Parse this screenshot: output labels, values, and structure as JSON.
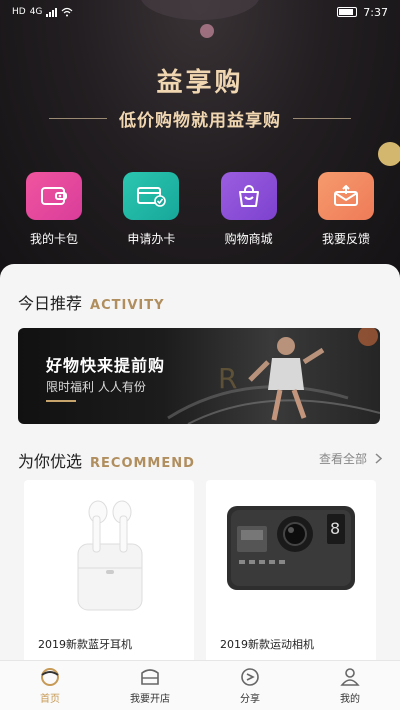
{
  "status_bar": {
    "network": "HD",
    "signal": "4G",
    "time": "7:37"
  },
  "header": {
    "title": "益享购",
    "slogan": "低价购物就用益享购"
  },
  "quick_actions": [
    {
      "label": "我的卡包",
      "icon": "wallet-icon",
      "color": "#e8449e"
    },
    {
      "label": "申请办卡",
      "icon": "card-check-icon",
      "color": "#1fb7a5"
    },
    {
      "label": "购物商城",
      "icon": "shopping-bag-icon",
      "color": "#8d4fd8"
    },
    {
      "label": "我要反馈",
      "icon": "envelope-icon",
      "color": "#f28a62"
    }
  ],
  "today": {
    "title": "今日推荐",
    "subtitle": "ACTIVITY",
    "banner": {
      "title": "好物快来提前购",
      "subtitle": "限时福利 人人有份"
    }
  },
  "recommend": {
    "title": "为你优选",
    "subtitle": "RECOMMEND",
    "view_all": "查看全部",
    "products": [
      {
        "name": "2019新款蓝牙耳机",
        "image": "earbuds-image"
      },
      {
        "name": "2019新款运动相机",
        "image": "action-camera-image"
      }
    ]
  },
  "tabbar": {
    "items": [
      {
        "label": "首页",
        "active": true
      },
      {
        "label": "我要开店",
        "active": false
      },
      {
        "label": "分享",
        "active": false
      },
      {
        "label": "我的",
        "active": false
      }
    ],
    "active_color": "#c79a56"
  }
}
